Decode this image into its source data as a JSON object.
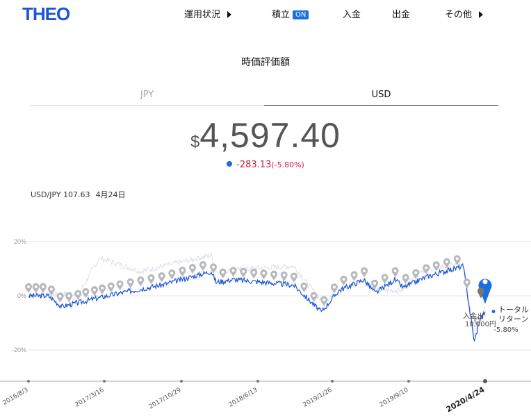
{
  "header": {
    "logo": "THEO",
    "nav": [
      {
        "label": "運用状況",
        "has_arrow": true
      },
      {
        "label": "積立",
        "badge": "ON"
      },
      {
        "label": "入金"
      },
      {
        "label": "出金"
      },
      {
        "label": "その他",
        "has_arrow": true
      }
    ]
  },
  "page_title": "時価評価額",
  "tabs": [
    {
      "label": "JPY",
      "selected": false
    },
    {
      "label": "USD",
      "selected": true
    }
  ],
  "balance": {
    "currency": "$",
    "amount": "4,597.40"
  },
  "change": {
    "value": "-283.13",
    "percent": "(-5.80%)"
  },
  "fx": {
    "rate": "USD/JPY 107.63",
    "date": "4月24日"
  },
  "colors": {
    "brand": "#1d55d8",
    "accent": "#1a6fe0",
    "negative": "#d0193c",
    "marker": "#b7b7bf"
  },
  "chart_data": {
    "type": "line",
    "y_ticks": [
      "20%",
      "0%",
      "-20%"
    ],
    "y_range": [
      -20,
      20
    ],
    "x_tick_labels": [
      "2016/8/3",
      "2017/3/16",
      "2017/10/29",
      "2018/6/13",
      "2019/1/26",
      "2019/9/10",
      "2020/4/24"
    ],
    "x_tick_dates": [
      "2016-08-03",
      "2017-03-16",
      "2017-10-29",
      "2018-06-13",
      "2019-01-26",
      "2019-09-10",
      "2020-04-24"
    ],
    "current_date_label": "2020/4/24",
    "series": [
      {
        "values_pct": [
          {
            "date": "2016-08-03",
            "y": 0
          },
          {
            "date": "2016-10-01",
            "y": 0
          },
          {
            "date": "2016-11-10",
            "y": -4
          },
          {
            "date": "2017-01-15",
            "y": -2
          },
          {
            "date": "2017-05-01",
            "y": 1
          },
          {
            "date": "2017-09-01",
            "y": 4
          },
          {
            "date": "2018-01-26",
            "y": 9
          },
          {
            "date": "2018-02-09",
            "y": 5
          },
          {
            "date": "2018-04-01",
            "y": 6
          },
          {
            "date": "2018-09-30",
            "y": 4
          },
          {
            "date": "2018-12-24",
            "y": -6
          },
          {
            "date": "2019-02-15",
            "y": 2
          },
          {
            "date": "2019-04-30",
            "y": 6
          },
          {
            "date": "2019-06-03",
            "y": 1
          },
          {
            "date": "2019-07-31",
            "y": 6
          },
          {
            "date": "2019-08-25",
            "y": 3
          },
          {
            "date": "2019-11-01",
            "y": 7
          },
          {
            "date": "2020-02-19",
            "y": 11
          },
          {
            "date": "2020-03-23",
            "y": -17
          },
          {
            "date": "2020-04-08",
            "y": -9
          },
          {
            "date": "2020-04-24",
            "y": -5.8
          }
        ]
      },
      {
        "values_pct": [
          {
            "date": "2016-08-03",
            "y": 0
          },
          {
            "date": "2017-01-01",
            "y": 1
          },
          {
            "date": "2017-03-01",
            "y": 14
          },
          {
            "date": "2017-07-01",
            "y": 9
          },
          {
            "date": "2018-01-26",
            "y": 15
          },
          {
            "date": "2018-02-09",
            "y": 9
          },
          {
            "date": "2018-09-30",
            "y": 11
          },
          {
            "date": "2018-12-24",
            "y": -2
          },
          {
            "date": "2019-04-30",
            "y": 6
          },
          {
            "date": "2019-06-03",
            "y": 2
          },
          {
            "date": "2019-08-25",
            "y": 2
          },
          {
            "date": "2019-10-01",
            "y": 9
          },
          {
            "date": "2020-02-19",
            "y": 12
          },
          {
            "date": "2020-03-23",
            "y": -14
          },
          {
            "date": "2020-04-24",
            "y": -4
          }
        ]
      }
    ],
    "deposit_markers": [
      "2016-08-03",
      "2016-08-25",
      "2016-09-15",
      "2016-10-10",
      "2016-11-05",
      "2016-12-01",
      "2016-12-28",
      "2017-01-20",
      "2017-02-15",
      "2017-03-10",
      "2017-04-05",
      "2017-05-01",
      "2017-06-01",
      "2017-07-01",
      "2017-08-01",
      "2017-09-01",
      "2017-10-01",
      "2017-11-01",
      "2017-12-01",
      "2018-01-01",
      "2018-02-01",
      "2018-03-01",
      "2018-04-01",
      "2018-05-01",
      "2018-06-01",
      "2018-07-01",
      "2018-08-01",
      "2018-09-01",
      "2018-10-01",
      "2018-11-01",
      "2018-12-01",
      "2019-01-01",
      "2019-02-01",
      "2019-03-01",
      "2019-04-01",
      "2019-05-01",
      "2019-06-01",
      "2019-07-01",
      "2019-08-01",
      "2019-09-01",
      "2019-10-01",
      "2019-11-01",
      "2019-12-01",
      "2020-01-01",
      "2020-02-01",
      "2020-03-01",
      "2020-04-01"
    ],
    "annotations": {
      "deposit_label": "入金",
      "deposit_amount": "10,000円",
      "withdraw_label": "出",
      "total_return_label": "トータル\nリターン",
      "total_return_value": "-5.80%"
    }
  }
}
